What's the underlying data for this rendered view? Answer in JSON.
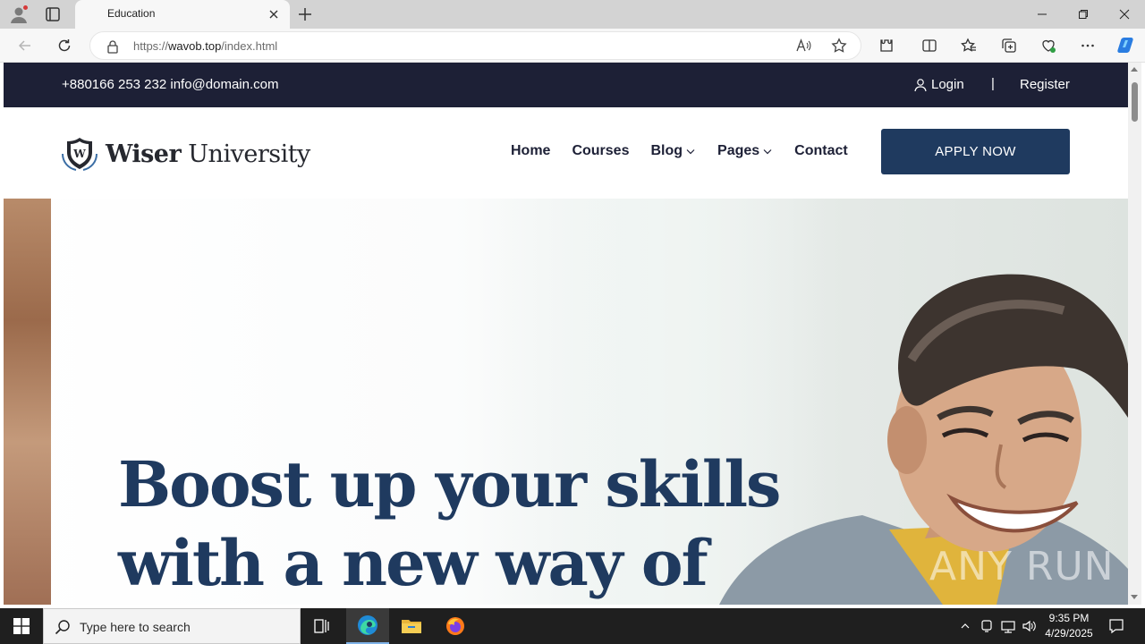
{
  "browser": {
    "tab_title": "Education",
    "url_prefix": "https://",
    "url_host": "wavob.top",
    "url_path": "/index.html"
  },
  "topbar": {
    "contact": "+880166 253 232 info@domain.com",
    "login": "Login",
    "separator": "|",
    "register": "Register"
  },
  "navbar": {
    "logo_strong": "Wiser",
    "logo_light": " University",
    "items": [
      {
        "label": "Home"
      },
      {
        "label": "Courses"
      },
      {
        "label": "Blog"
      },
      {
        "label": "Pages"
      },
      {
        "label": "Contact"
      }
    ],
    "apply_label": "APPLY NOW"
  },
  "hero": {
    "line1": "Boost up your skills",
    "line2": "with a new way of"
  },
  "watermark": "ANY RUN",
  "taskbar": {
    "search_placeholder": "Type here to search",
    "time": "9:35 PM",
    "date": "4/29/2025"
  },
  "colors": {
    "topbar_bg": "#1d2036",
    "accent": "#1f3a5f"
  }
}
